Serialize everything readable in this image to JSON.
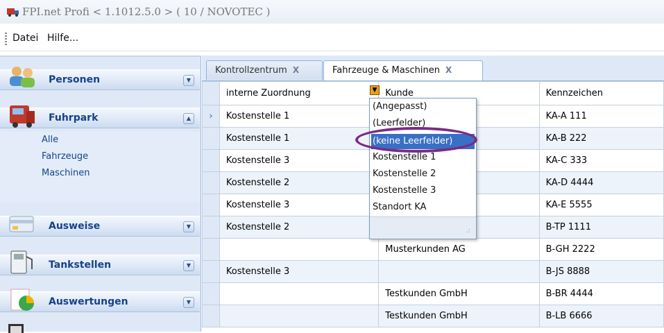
{
  "window": {
    "title": "FPI.net Profi < 1.1012.5.0 > ( 10 / NOVOTEC )"
  },
  "menu": {
    "items": [
      "Datei",
      "Hilfe..."
    ]
  },
  "sidebar": {
    "groups": [
      {
        "label": "Personen",
        "icon": "people-icon",
        "chevron": "down"
      },
      {
        "label": "Fuhrpark",
        "icon": "truck-icon",
        "chevron": "up"
      },
      {
        "label": "Ausweise",
        "icon": "card-icon",
        "chevron": "down"
      },
      {
        "label": "Tankstellen",
        "icon": "fuel-pump-icon",
        "chevron": "down"
      },
      {
        "label": "Auswertungen",
        "icon": "chart-icon",
        "chevron": "down"
      }
    ],
    "fuhrpark_items": [
      "Alle",
      "Fahrzeuge",
      "Maschinen"
    ]
  },
  "tabs": [
    {
      "label": "Kontrollzentrum",
      "close": "X"
    },
    {
      "label": "Fahrzeuge & Maschinen",
      "close": "X"
    }
  ],
  "grid": {
    "columns": [
      "interne Zuordnung",
      "Kunde",
      "Kennzeichen"
    ],
    "rows": [
      [
        "Kostenstelle 1",
        "",
        "KA-A 111"
      ],
      [
        "Kostenstelle 1",
        "",
        "KA-B 222"
      ],
      [
        "Kostenstelle 3",
        "",
        "KA-C 333"
      ],
      [
        "Kostenstelle 2",
        "",
        "KA-D 4444"
      ],
      [
        "Kostenstelle 3",
        "",
        "KA-E 5555"
      ],
      [
        "Kostenstelle 2",
        "",
        "B-TP 1111"
      ],
      [
        "",
        "Musterkunden AG",
        "B-GH 2222"
      ],
      [
        "Kostenstelle 3",
        "",
        "B-JS 8888"
      ],
      [
        "",
        "Testkunden GmbH",
        "B-BR 4444"
      ],
      [
        "",
        "Testkunden GmbH",
        "B-LB 6666"
      ]
    ]
  },
  "filter_dropdown": {
    "items": [
      "(Angepasst)",
      "(Leerfelder)",
      "(keine Leerfelder)",
      "Kostenstelle 1",
      "Kostenstelle 2",
      "Kostenstelle 3",
      "Standort KA"
    ],
    "selected": "(keine Leerfelder)"
  },
  "colors": {
    "selection": "#3a6fc6",
    "annotation": "#7a2b86",
    "header_text": "#15428b"
  }
}
